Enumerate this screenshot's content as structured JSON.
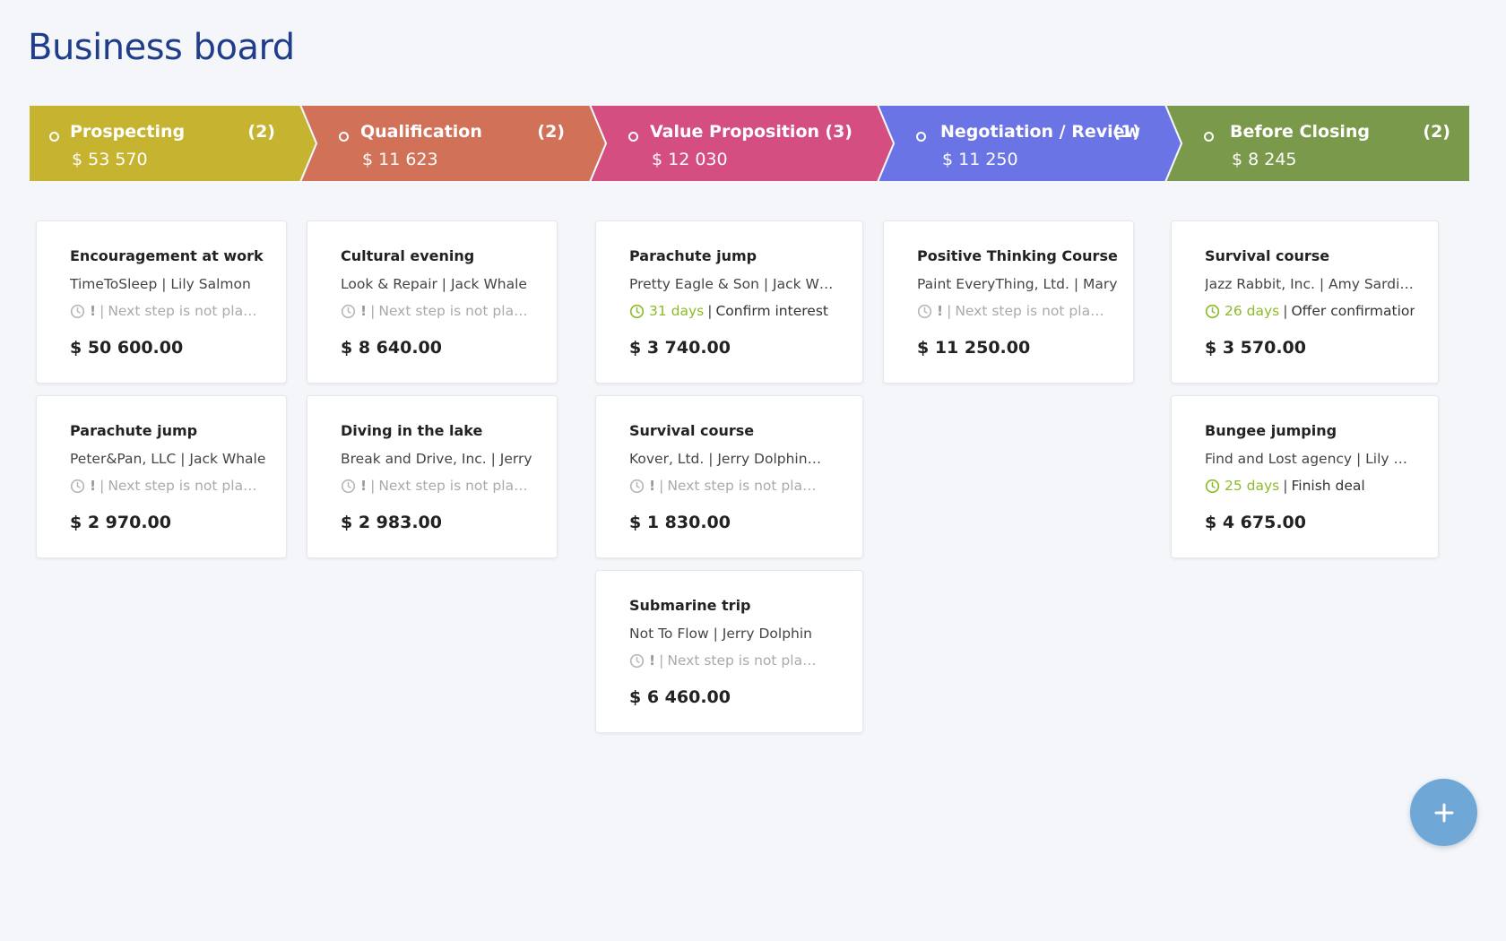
{
  "page": {
    "title": "Business board"
  },
  "stages": [
    {
      "name": "Prospecting",
      "count": "(2)",
      "total": "$ 53 570",
      "color": "#c6b431"
    },
    {
      "name": "Qualification",
      "count": "(2)",
      "total": "$ 11 623",
      "color": "#d17158"
    },
    {
      "name": "Value Proposition",
      "count": "(3)",
      "total": "$ 12 030",
      "color": "#d44e82"
    },
    {
      "name": "Negotiation / Review",
      "count": "(1)",
      "total": "$ 11 250",
      "color": "#6b74e4"
    },
    {
      "name": "Before Closing",
      "count": "(2)",
      "total": "$ 8 245",
      "color": "#7a994a"
    }
  ],
  "columns": [
    {
      "cards": [
        {
          "title": "Encouragement at work",
          "client": "TimeToSleep | Lily Salmon",
          "planned": false,
          "warn": "!",
          "sep": "|",
          "next_step": "Next step is not pla…",
          "amount": "$ 50 600.00"
        },
        {
          "title": "Parachute jump",
          "client": "Peter&Pan, LLC | Jack Whale",
          "planned": false,
          "warn": "!",
          "sep": "|",
          "next_step": "Next step is not pla…",
          "amount": "$ 2 970.00"
        }
      ]
    },
    {
      "cards": [
        {
          "title": "Cultural evening",
          "client": "Look & Repair | Jack Whale",
          "planned": false,
          "warn": "!",
          "sep": "|",
          "next_step": "Next step is not pla…",
          "amount": "$ 8 640.00"
        },
        {
          "title": "Diving in the lake",
          "client": "Break and Drive, Inc. | Jerry",
          "planned": false,
          "warn": "!",
          "sep": "|",
          "next_step": "Next step is not pla…",
          "amount": "$ 2 983.00"
        }
      ]
    },
    {
      "cards": [
        {
          "title": "Parachute jump",
          "client": "Pretty Eagle & Son | Jack Wh…",
          "planned": true,
          "days": "31 days",
          "sep": "|",
          "next_step": "Confirm interest",
          "amount": "$ 3 740.00"
        },
        {
          "title": "Survival course",
          "client": "Kover, Ltd. | Jerry Dolphin…",
          "planned": false,
          "warn": "!",
          "sep": "|",
          "next_step": "Next step is not pla…",
          "amount": "$ 1 830.00"
        },
        {
          "title": "Submarine trip",
          "client": "Not To Flow | Jerry Dolphin",
          "planned": false,
          "warn": "!",
          "sep": "|",
          "next_step": "Next step is not pla…",
          "amount": "$ 6 460.00"
        }
      ]
    },
    {
      "cards": [
        {
          "title": "Positive Thinking Course",
          "client": "Paint EveryThing, Ltd. | Mary",
          "planned": false,
          "warn": "!",
          "sep": "|",
          "next_step": "Next step is not pla…",
          "amount": "$ 11 250.00"
        }
      ]
    },
    {
      "cards": [
        {
          "title": "Survival course",
          "client": "Jazz Rabbit, Inc. | Amy Sardine",
          "planned": true,
          "days": "26 days",
          "sep": "|",
          "next_step": "Offer confirmation?",
          "amount": "$ 3 570.00"
        },
        {
          "title": "Bungee jumping",
          "client": "Find and Lost agency | Lily Salmon",
          "planned": true,
          "days": "25 days",
          "sep": "|",
          "next_step": "Finish deal",
          "amount": "$ 4 675.00"
        }
      ]
    }
  ],
  "fab": {
    "label": "+"
  },
  "colors": {
    "title": "#1f3d8a",
    "days": "#8dbb2a",
    "fab": "#6fa8d6"
  }
}
